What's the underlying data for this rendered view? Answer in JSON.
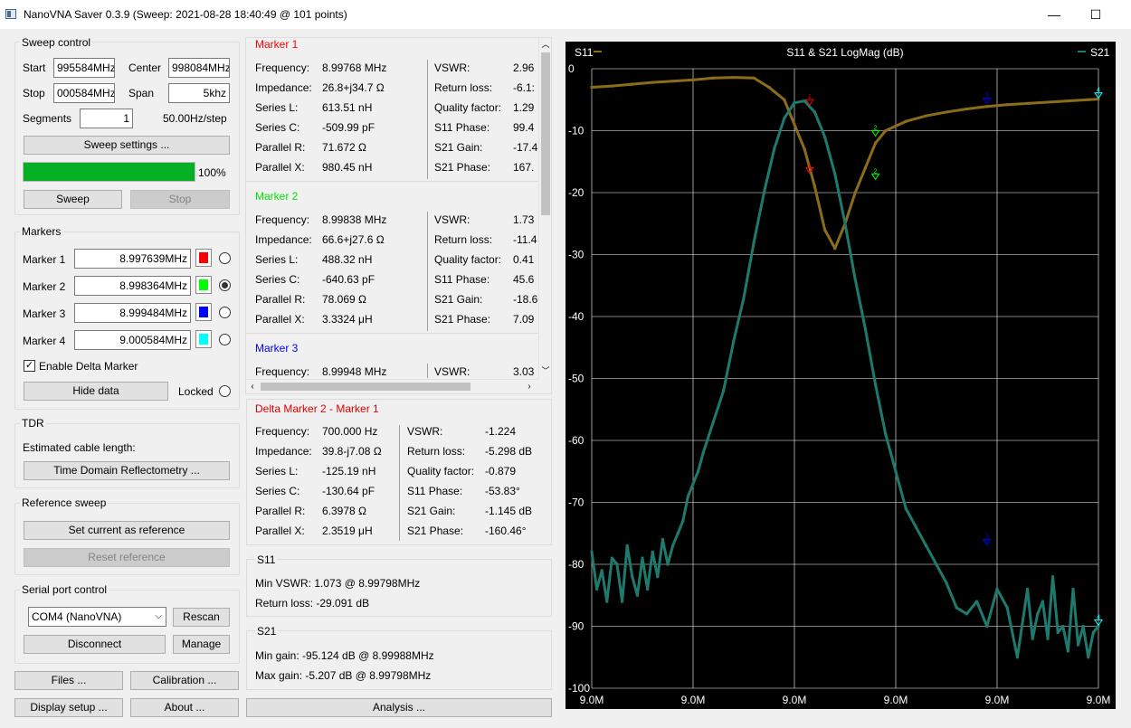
{
  "window": {
    "title": "NanoVNA Saver 0.3.9 (Sweep: 2021-08-28 18:40:49 @ 101 points)",
    "minimize": "—",
    "maximize": "☐"
  },
  "sweep": {
    "group_title": "Sweep control",
    "start_label": "Start",
    "start_value": "995584MHz",
    "center_label": "Center",
    "center_value": "998084MHz",
    "stop_label": "Stop",
    "stop_value": "000584MHz",
    "span_label": "Span",
    "span_value": "5khz",
    "segments_label": "Segments",
    "segments_value": "1",
    "step_text": "50.00Hz/step",
    "settings_button": "Sweep settings ...",
    "progress": 100,
    "progress_text": "100%",
    "sweep_button": "Sweep",
    "stop_button": "Stop"
  },
  "markers": {
    "group_title": "Markers",
    "items": [
      {
        "label": "Marker 1",
        "value": "8.997639MHz",
        "color": "#ff0000",
        "selected": false
      },
      {
        "label": "Marker 2",
        "value": "8.998364MHz",
        "color": "#00ff00",
        "selected": true
      },
      {
        "label": "Marker 3",
        "value": "8.999484MHz",
        "color": "#0000ff",
        "selected": false
      },
      {
        "label": "Marker 4",
        "value": "9.000584MHz",
        "color": "#00ffff",
        "selected": false
      }
    ],
    "enable_delta": "Enable Delta Marker",
    "hide_data_button": "Hide data",
    "locked_label": "Locked"
  },
  "tdr": {
    "group_title": "TDR",
    "cable_label": "Estimated cable length:",
    "button": "Time Domain Reflectometry ..."
  },
  "reference": {
    "group_title": "Reference sweep",
    "set_button": "Set current as reference",
    "reset_button": "Reset reference"
  },
  "serial": {
    "group_title": "Serial port control",
    "port_value": "COM4 (NanoVNA)",
    "rescan_button": "Rescan",
    "disconnect_button": "Disconnect",
    "manage_button": "Manage"
  },
  "bottom_buttons": {
    "files": "Files ...",
    "calibration": "Calibration ...",
    "display": "Display setup ...",
    "about": "About ...",
    "analysis": "Analysis ..."
  },
  "marker_details": [
    {
      "title": "Marker 1",
      "color": "#ff0000",
      "left": [
        [
          "Frequency:",
          "8.99768 MHz"
        ],
        [
          "Impedance:",
          "26.8+j34.7 Ω"
        ],
        [
          "Series L:",
          "613.51 nH"
        ],
        [
          "Series C:",
          "-509.99 pF"
        ],
        [
          "Parallel R:",
          "71.672 Ω"
        ],
        [
          "Parallel X:",
          "980.45 nH"
        ]
      ],
      "right": [
        [
          "VSWR:",
          "2.96"
        ],
        [
          "Return loss:",
          "-6.1:"
        ],
        [
          "Quality factor:",
          "1.29"
        ],
        [
          "S11 Phase:",
          "99.4"
        ],
        [
          "S21 Gain:",
          "-17.4"
        ],
        [
          "S21 Phase:",
          "167."
        ]
      ]
    },
    {
      "title": "Marker 2",
      "color": "#00e600",
      "left": [
        [
          "Frequency:",
          "8.99838 MHz"
        ],
        [
          "Impedance:",
          "66.6+j27.6 Ω"
        ],
        [
          "Series L:",
          "488.32 nH"
        ],
        [
          "Series C:",
          "-640.63 pF"
        ],
        [
          "Parallel R:",
          "78.069 Ω"
        ],
        [
          "Parallel X:",
          "3.3324 μH"
        ]
      ],
      "right": [
        [
          "VSWR:",
          "1.73"
        ],
        [
          "Return loss:",
          "-11.4"
        ],
        [
          "Quality factor:",
          "0.41"
        ],
        [
          "S11 Phase:",
          "45.6"
        ],
        [
          "S21 Gain:",
          "-18.6"
        ],
        [
          "S21 Phase:",
          "7.09"
        ]
      ]
    },
    {
      "title": "Marker 3",
      "color": "#0000ff",
      "left": [
        [
          "Frequency:",
          "8.99948 MHz"
        ]
      ],
      "right": [
        [
          "VSWR:",
          "3.03"
        ]
      ]
    }
  ],
  "delta": {
    "title": "Delta Marker 2 - Marker 1",
    "left": [
      [
        "Frequency:",
        "700.000 Hz"
      ],
      [
        "Impedance:",
        "39.8-j7.08 Ω"
      ],
      [
        "Series L:",
        "-125.19 nH"
      ],
      [
        "Series C:",
        "-130.64 pF"
      ],
      [
        "Parallel R:",
        "6.3978 Ω"
      ],
      [
        "Parallel X:",
        "2.3519 μH"
      ]
    ],
    "right": [
      [
        "VSWR:",
        "-1.224"
      ],
      [
        "Return loss:",
        "-5.298 dB"
      ],
      [
        "Quality factor:",
        "-0.879"
      ],
      [
        "S11 Phase:",
        "-53.83°"
      ],
      [
        "S21 Gain:",
        "-1.145 dB"
      ],
      [
        "S21 Phase:",
        "-160.46°"
      ]
    ]
  },
  "s11_summary": {
    "title": "S11",
    "min_vswr": "Min VSWR:  1.073 @ 8.99798MHz",
    "return_loss": "Return loss:  -29.091 dB"
  },
  "s21_summary": {
    "title": "S21",
    "min_gain": "Min gain:  -95.124 dB @ 8.99988MHz",
    "max_gain": "Max gain:  -5.207 dB @ 8.99798MHz"
  },
  "chart_data": {
    "type": "line",
    "title": "S11 & S21 LogMag (dB)",
    "legend_left": "S11",
    "legend_right": "S21",
    "ylim": [
      -100,
      0
    ],
    "yticks": [
      "0",
      "-10",
      "-20",
      "-30",
      "-40",
      "-50",
      "-60",
      "-70",
      "-80",
      "-90",
      "-100"
    ],
    "xticks": [
      "9.0M",
      "9.0M",
      "9.0M",
      "9.0M",
      "9.0M",
      "9.0M"
    ],
    "grid": true,
    "colors": {
      "s11": "#8a6d1a",
      "s21": "#1f7a6e",
      "grid": "#ffffff",
      "axis_text": "#ffffff"
    },
    "series": [
      {
        "name": "S11",
        "x": [
          0,
          4,
          8,
          12,
          16,
          20,
          24,
          28,
          32,
          35,
          38,
          40,
          42,
          44,
          46,
          48,
          50,
          52,
          54,
          56,
          58,
          62,
          66,
          70,
          74,
          78,
          82,
          86,
          90,
          94,
          98,
          100
        ],
        "values": [
          -3,
          -2.8,
          -2.5,
          -2.2,
          -2,
          -1.8,
          -1.5,
          -1.4,
          -1.5,
          -3,
          -5,
          -9,
          -13,
          -19,
          -26,
          -29,
          -25,
          -20,
          -16,
          -12,
          -10,
          -8.5,
          -7.6,
          -7,
          -6.5,
          -6.1,
          -5.8,
          -5.6,
          -5.4,
          -5.2,
          -5.0,
          -4.9
        ]
      },
      {
        "name": "S21",
        "x": [
          0,
          1,
          2,
          3,
          4,
          5,
          6,
          7,
          8,
          9,
          10,
          11,
          12,
          13,
          14,
          15,
          16,
          17,
          18,
          19,
          20,
          21,
          22,
          24,
          26,
          28,
          30,
          32,
          34,
          36,
          38,
          40,
          42,
          44,
          46,
          48,
          50,
          52,
          54,
          56,
          58,
          60,
          62,
          64,
          66,
          68,
          70,
          72,
          74,
          76,
          78,
          80,
          82,
          84,
          86,
          87,
          88,
          89,
          90,
          91,
          92,
          93,
          94,
          95,
          96,
          97,
          98,
          99,
          100
        ],
        "values": [
          -78,
          -84,
          -81,
          -86,
          -79,
          -80,
          -86,
          -77,
          -82,
          -85,
          -79,
          -84,
          -78,
          -82,
          -76,
          -80,
          -77,
          -75,
          -73,
          -69,
          -67,
          -65,
          -62,
          -57,
          -52,
          -44,
          -37,
          -28,
          -20,
          -13,
          -8,
          -5.5,
          -5.2,
          -7,
          -11,
          -17,
          -25,
          -34,
          -42,
          -51,
          -59,
          -65,
          -71,
          -74,
          -77,
          -80,
          -83,
          -87,
          -88,
          -86,
          -90,
          -84,
          -87,
          -95,
          -84,
          -92,
          -88,
          -86,
          -92,
          -82,
          -91,
          -90,
          -94,
          -84,
          -93,
          -90,
          -95,
          -91,
          -90
        ]
      }
    ],
    "markers": [
      {
        "label": "1",
        "color": "#ff0000",
        "x": 43,
        "s11": -6,
        "s21": -17
      },
      {
        "label": "2",
        "color": "#00ff00",
        "x": 56,
        "s11": -11,
        "s21": -18
      },
      {
        "label": "3",
        "color": "#0000ff",
        "x": 78,
        "s11": -5.8,
        "s21": -77
      },
      {
        "label": "4",
        "color": "#00ffff",
        "x": 100,
        "s11": -4.9,
        "s21": -90
      }
    ]
  }
}
